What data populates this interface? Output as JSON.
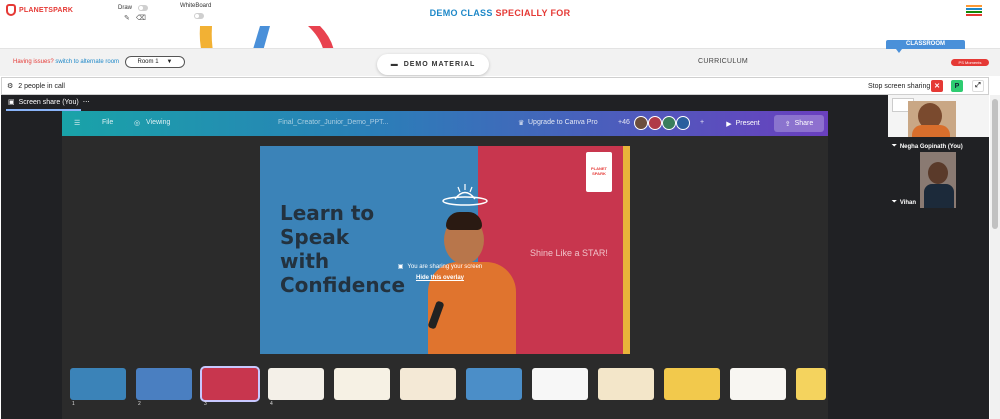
{
  "header": {
    "logo_text": "PLANETSPARK",
    "draw_label": "Draw",
    "whiteboard_label": "WhiteBoard",
    "title_part1": "DEMO CLASS",
    "title_part2": "SPECIALLY FOR",
    "title_color_1": "#1e88c8",
    "title_color_2": "#e53935",
    "flag_colors": [
      "#ff9933",
      "#1e88c8",
      "#138808",
      "#e53935"
    ]
  },
  "toolbar": {
    "issue_text": "Having issues?",
    "switch_link": "switch to alternate room",
    "room_value": "Room 1",
    "demo_material_label": "DEMO MATERIAL",
    "curriculum_label": "CURRICULUM",
    "classroom_label": "CLASSROOM",
    "pill_label": "PS Moments"
  },
  "callbar": {
    "people_count_text": "2 people in call",
    "stop_share_label": "Stop screen sharing",
    "p_button_label": "P"
  },
  "meeting": {
    "share_tab_label": "Screen share (You)",
    "canva": {
      "file_label": "File",
      "viewing_label": "Viewing",
      "doc_title": "Final_Creator_Junior_Demo_PPT...",
      "upgrade_label": "Upgrade to Canva Pro",
      "collaborator_count": "+46",
      "present_label": "Present",
      "share_label": "Share"
    },
    "slide": {
      "headline": [
        "Learn to",
        "Speak",
        "with",
        "Confidence"
      ],
      "tagline": "Shine Like a STAR!",
      "badge_text": "PLANET SPARK"
    },
    "overlay": {
      "sharing_text": "You are sharing your screen",
      "hide_link": "Hide this overlay"
    },
    "thumbnails": [
      {
        "color": "#3b83b8",
        "num": "1"
      },
      {
        "color": "#4a7fc1",
        "num": "2"
      },
      {
        "color": "#c8364e",
        "num": "3"
      },
      {
        "color": "#f4f0e8",
        "num": "4"
      },
      {
        "color": "#f6f1e4",
        "num": ""
      },
      {
        "color": "#f4e9d6",
        "num": ""
      },
      {
        "color": "#4b8ec8",
        "num": ""
      },
      {
        "color": "#f7f7f7",
        "num": ""
      },
      {
        "color": "#f3e6c9",
        "num": ""
      },
      {
        "color": "#f2c94c",
        "num": ""
      },
      {
        "color": "#f8f6f2",
        "num": ""
      },
      {
        "color": "#f4d35e",
        "num": ""
      },
      {
        "color": "#f6e8a8",
        "num": ""
      },
      {
        "color": "#e8edf2",
        "num": ""
      }
    ]
  },
  "participants": [
    {
      "name": "Negha Gopinath (You)"
    },
    {
      "name": "Vihan"
    }
  ]
}
